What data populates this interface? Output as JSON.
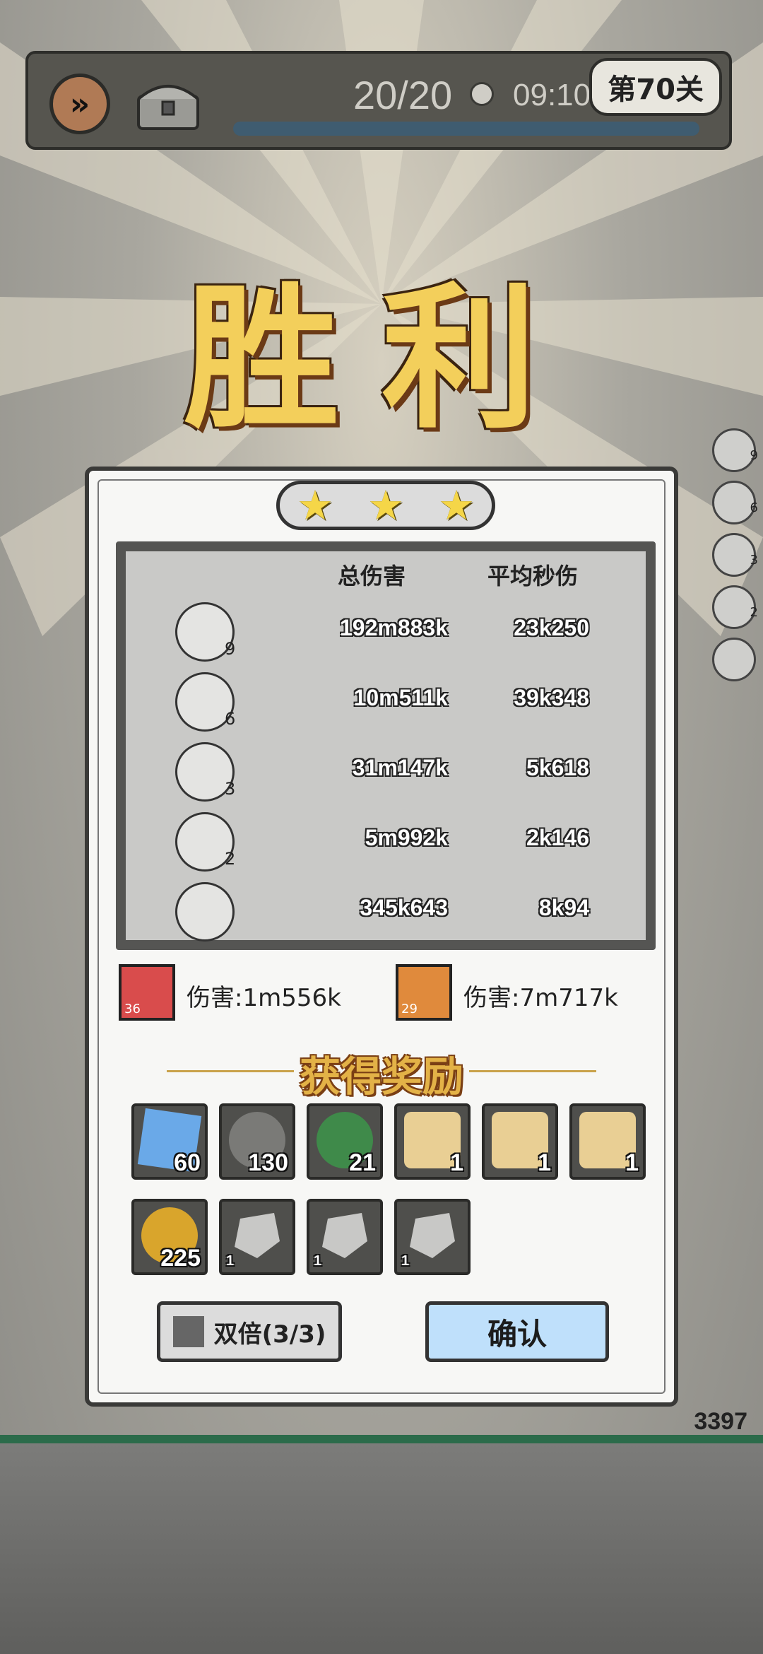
{
  "hud": {
    "wave": "20/20",
    "timer": "09:10",
    "level": "第70关"
  },
  "title": "胜利",
  "side_counts": [
    "9",
    "6",
    "3",
    "2"
  ],
  "stars": 3,
  "stats": {
    "col_total": "总伤害",
    "col_avg": "平均秒伤",
    "rows": [
      {
        "icon": "crystal-shard-icon",
        "level": "9",
        "total": "192m883k",
        "avg": "23k250"
      },
      {
        "icon": "ice-cluster-icon",
        "level": "6",
        "total": "10m511k",
        "avg": "39k348"
      },
      {
        "icon": "tornado-icon",
        "level": "3",
        "total": "31m147k",
        "avg": "5k618"
      },
      {
        "icon": "slash-icon",
        "level": "2",
        "total": "5m992k",
        "avg": "2k146"
      },
      {
        "icon": "lightning-icon",
        "level": "",
        "total": "345k643",
        "avg": "8k94"
      }
    ]
  },
  "heroes": [
    {
      "level": "36",
      "damage": "伤害:1m556k",
      "color": "#d94c4c"
    },
    {
      "level": "29",
      "damage": "伤害:7m717k",
      "color": "#e08a3c"
    }
  ],
  "reward_title": "获得奖励",
  "rewards": [
    {
      "icon": "blue-gem-icon",
      "count": "60",
      "small": false
    },
    {
      "icon": "green-leaf-icon",
      "count": "130",
      "small": false
    },
    {
      "icon": "exp-orb-icon",
      "count": "21",
      "small": false
    },
    {
      "icon": "scroll-icon",
      "count": "1",
      "small": false
    },
    {
      "icon": "scroll-icon",
      "count": "1",
      "small": false
    },
    {
      "icon": "scroll-icon",
      "count": "1",
      "small": false
    },
    {
      "icon": "gold-coin-icon",
      "count": "225",
      "small": false
    },
    {
      "icon": "ore-icon",
      "count": "1",
      "small": true
    },
    {
      "icon": "ore-icon",
      "count": "1",
      "small": true
    },
    {
      "icon": "ore-icon",
      "count": "1",
      "small": true
    }
  ],
  "buttons": {
    "double": "双倍(3/3)",
    "confirm": "确认"
  },
  "boss_hp": "3397",
  "colors": {
    "gold": "#f3cf5b",
    "confirm_bg": "#bfe0fb",
    "panel": "#f7f7f5"
  }
}
